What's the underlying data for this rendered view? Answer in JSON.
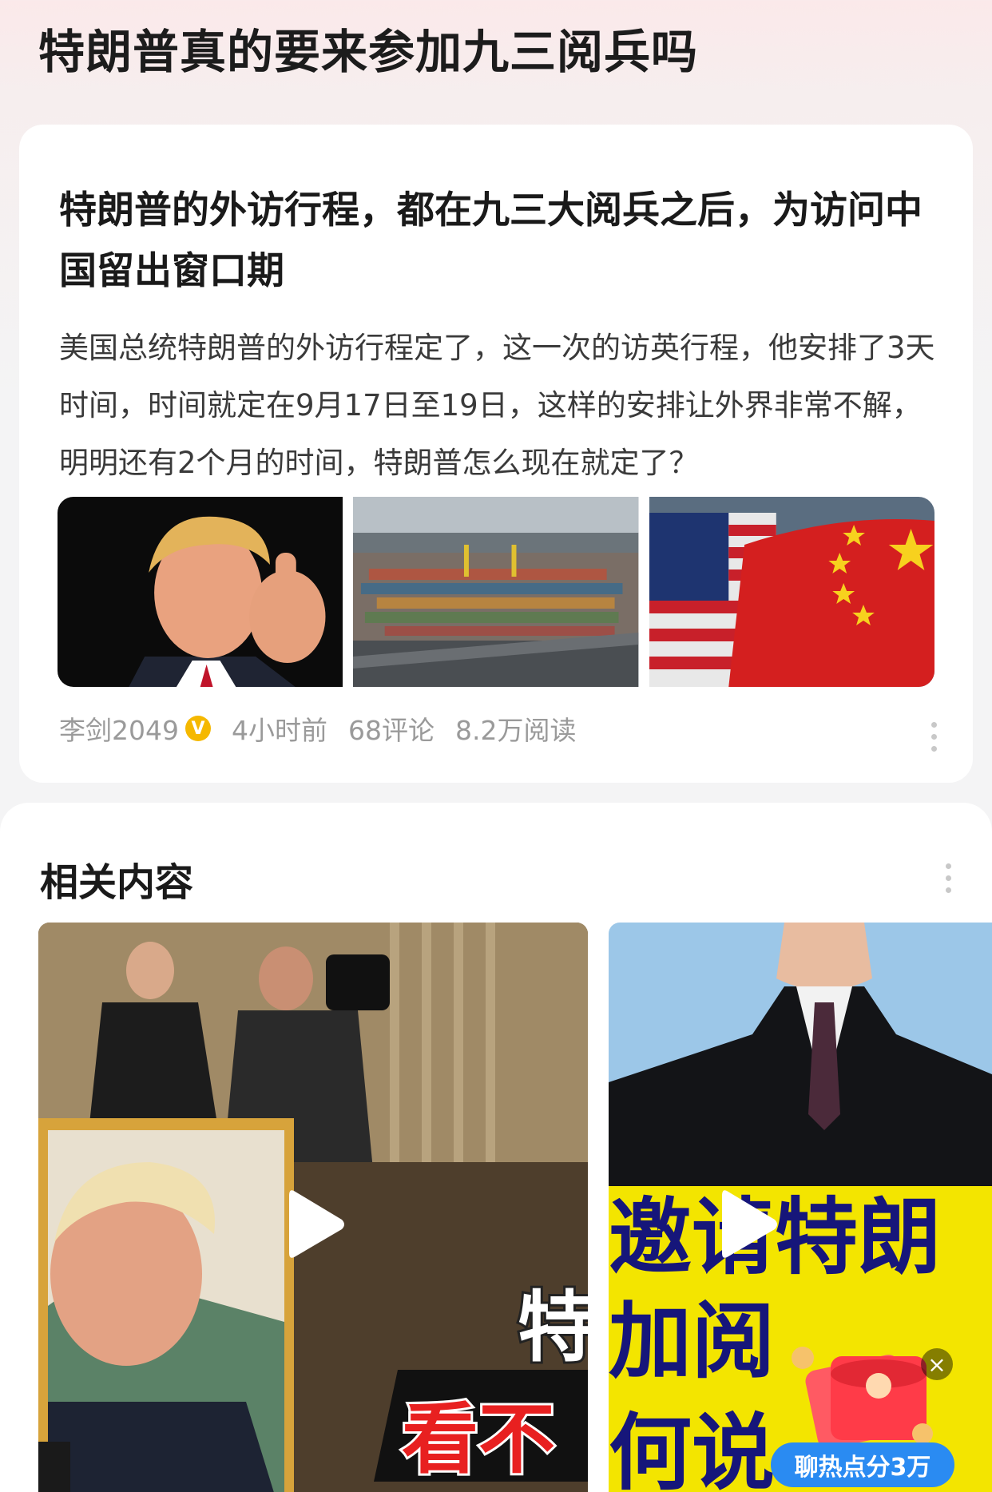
{
  "page": {
    "title": "特朗普真的要来参加九三阅兵吗"
  },
  "article": {
    "headline": "特朗普的外访行程，都在九三大阅兵之后，为访问中国留出窗口期",
    "summary": "美国总统特朗普的外访行程定了，这一次的访英行程，他安排了3天时间，时间就定在9月17日至19日，这样的安排让外界非常不解，明明还有2个月的时间，特朗普怎么现在就定了？",
    "author": "李剑2049",
    "verified_badge": "V",
    "time": "4小时前",
    "comments": "68评论",
    "reads": "8.2万阅读"
  },
  "related": {
    "title": "相关内容",
    "video_left_overlay": "特",
    "video_left_banner": "看不",
    "video_right_overlay_lines": [
      "邀请特朗",
      "加阅",
      "何说"
    ]
  },
  "promo": {
    "label": "聊热点分3万",
    "close": "×"
  }
}
